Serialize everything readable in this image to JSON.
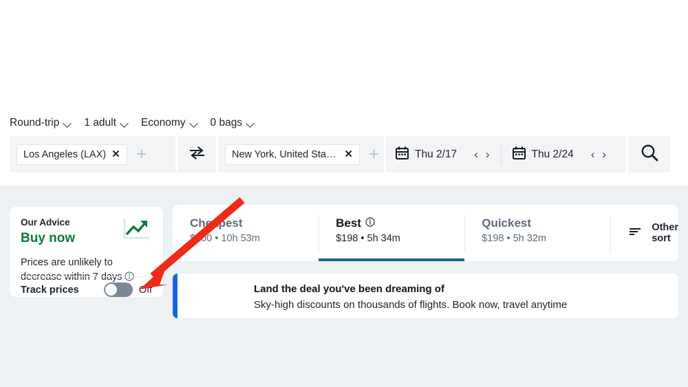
{
  "search": {
    "options": [
      {
        "label": "Round-trip",
        "icon": "chevron-down-icon"
      },
      {
        "label": "1 adult",
        "icon": "chevron-down-icon"
      },
      {
        "label": "Economy",
        "icon": "chevron-down-icon"
      },
      {
        "label": "0 bags",
        "icon": "chevron-down-icon"
      }
    ],
    "origin": {
      "value": "Los Angeles (LAX)",
      "remove_label": "✕",
      "add_label": "+"
    },
    "destination": {
      "value": "New York, United State…",
      "remove_label": "✕",
      "add_label": "+"
    },
    "swap_icon": "swap-arrows-icon",
    "depart_date": {
      "label": "Thu 2/17",
      "prev": "‹",
      "next": "›",
      "icon": "calendar-icon"
    },
    "return_date": {
      "label": "Thu 2/24",
      "prev": "‹",
      "next": "›",
      "icon": "calendar-icon"
    },
    "search_icon": "search-icon"
  },
  "advice": {
    "kicker": "Our Advice",
    "headline": "Buy now",
    "headline_color": "#0a7a3d",
    "body": "Prices are unlikely to decrease within 7 days",
    "info_icon": "info-circle-icon",
    "trend_icon": "trending-up-icon",
    "track_label": "Track prices",
    "track_state": "Off",
    "track_on": false
  },
  "sort": {
    "tabs": [
      {
        "title": "Cheapest",
        "subtitle": "$100 • 10h 53m",
        "active": false,
        "has_info": false
      },
      {
        "title": "Best",
        "subtitle": "$198 • 5h 34m",
        "active": true,
        "has_info": true,
        "info_icon": "info-circle-icon"
      },
      {
        "title": "Quickest",
        "subtitle": "$198 • 5h 32m",
        "active": false,
        "has_info": false
      }
    ],
    "other_sort_label": "Other sort",
    "other_sort_icon": "sort-lines-icon",
    "active_underline_color": "#136b81"
  },
  "promo": {
    "title": "Land the deal you've been dreaming of",
    "subtitle": "Sky-high discounts on thousands of flights. Book now, travel anytime",
    "stripe_color": "#1266e3"
  },
  "annotation": {
    "arrow_color": "#ee2a18",
    "points_to": "track-prices-toggle"
  }
}
